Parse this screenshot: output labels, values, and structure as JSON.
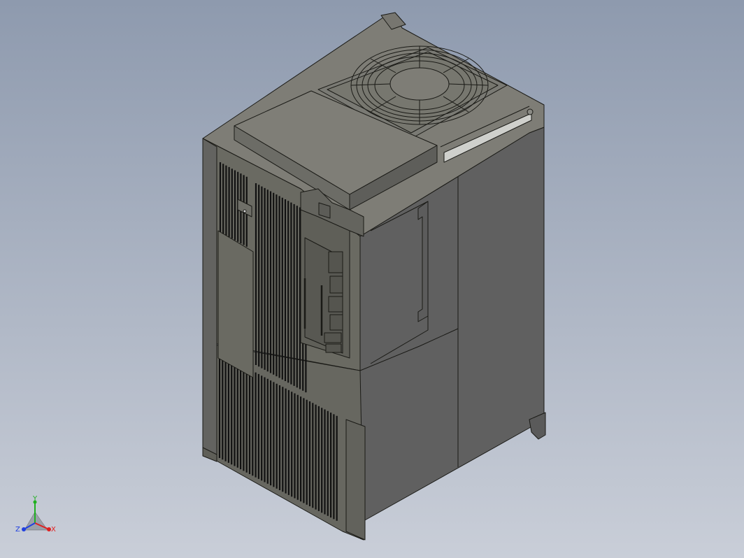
{
  "viewport": {
    "background_top": "#8e9aae",
    "background_bottom": "#c9ced8"
  },
  "model": {
    "body_color": "#696a62",
    "front_color": "#6a6a62",
    "side_color": "#606060",
    "top_color": "#7e7d76",
    "edge_color": "#1a1a16",
    "fan_icon": "fan-guard-icon"
  },
  "triad": {
    "x_label": "X",
    "y_label": "Y",
    "z_label": "Z",
    "x_color": "#e02020",
    "y_color": "#20b020",
    "z_color": "#2040e0"
  }
}
